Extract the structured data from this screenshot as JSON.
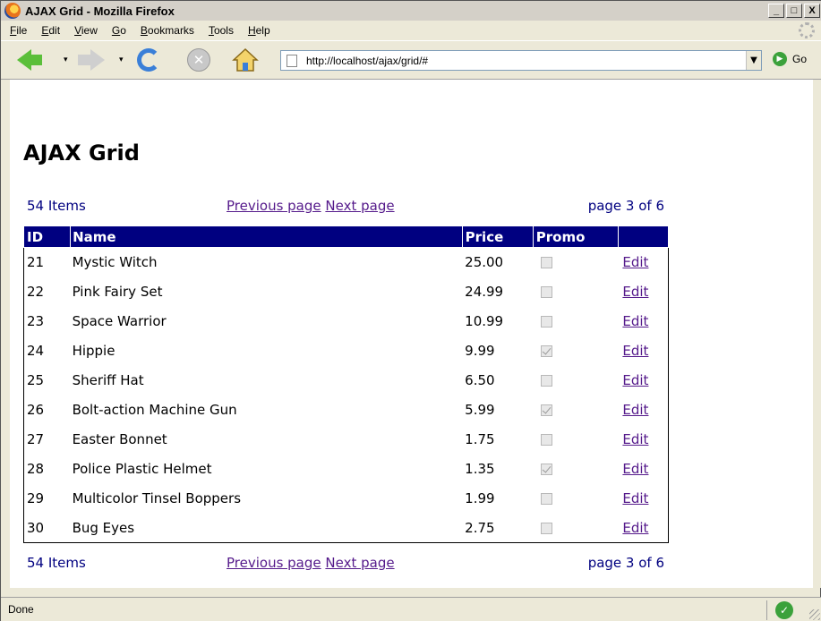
{
  "window": {
    "title": "AJAX Grid - Mozilla Firefox",
    "buttons": {
      "minimize": "_",
      "maximize": "□",
      "close": "X"
    }
  },
  "menu": {
    "items": [
      {
        "first": "F",
        "rest": "ile"
      },
      {
        "first": "E",
        "rest": "dit"
      },
      {
        "first": "V",
        "rest": "iew"
      },
      {
        "first": "G",
        "rest": "o"
      },
      {
        "first": "B",
        "rest": "ookmarks"
      },
      {
        "first": "T",
        "rest": "ools"
      },
      {
        "first": "H",
        "rest": "elp"
      }
    ]
  },
  "toolbar": {
    "url": "http://localhost/ajax/grid/#",
    "go_label": "Go",
    "icons": [
      "back-icon",
      "forward-icon",
      "reload-icon",
      "stop-icon",
      "home-icon"
    ]
  },
  "page": {
    "title": "AJAX Grid",
    "pager": {
      "count": "54 Items",
      "prev": "Previous page",
      "next": "Next page",
      "page_info": "page 3 of 6"
    },
    "grid": {
      "headers": [
        "ID",
        "Name",
        "Price",
        "Promo",
        ""
      ],
      "edit_label": "Edit",
      "rows": [
        {
          "id": "21",
          "name": "Mystic Witch",
          "price": "25.00",
          "promo": false
        },
        {
          "id": "22",
          "name": "Pink Fairy Set",
          "price": "24.99",
          "promo": false
        },
        {
          "id": "23",
          "name": "Space Warrior",
          "price": "10.99",
          "promo": false
        },
        {
          "id": "24",
          "name": "Hippie",
          "price": "9.99",
          "promo": true
        },
        {
          "id": "25",
          "name": "Sheriff Hat",
          "price": "6.50",
          "promo": false
        },
        {
          "id": "26",
          "name": "Bolt-action Machine Gun",
          "price": "5.99",
          "promo": true
        },
        {
          "id": "27",
          "name": "Easter Bonnet",
          "price": "1.75",
          "promo": false
        },
        {
          "id": "28",
          "name": "Police Plastic Helmet",
          "price": "1.35",
          "promo": true
        },
        {
          "id": "29",
          "name": "Multicolor Tinsel Boppers",
          "price": "1.99",
          "promo": false
        },
        {
          "id": "30",
          "name": "Bug Eyes",
          "price": "2.75",
          "promo": false
        }
      ]
    }
  },
  "status": {
    "text": "Done"
  },
  "colors": {
    "header_bg": "#000080",
    "link": "#551a8b",
    "pager_text": "#000080"
  }
}
